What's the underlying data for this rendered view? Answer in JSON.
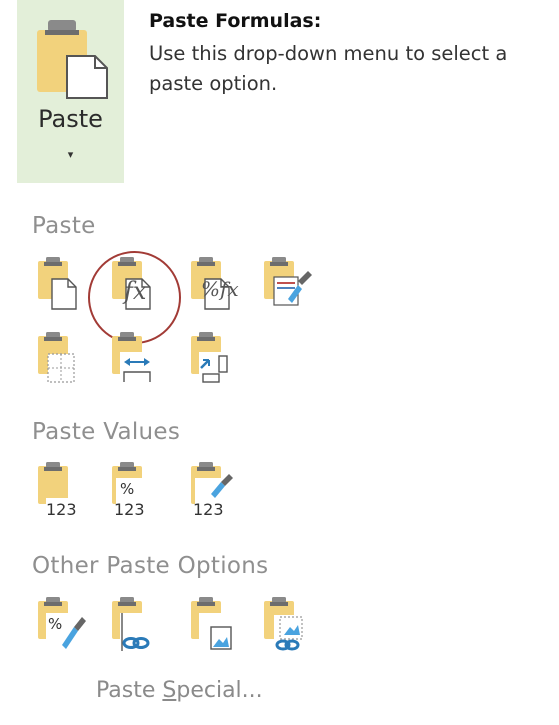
{
  "paste_button": {
    "label": "Paste",
    "arrow": "▾"
  },
  "description": {
    "title": "Paste Formulas:",
    "body": "Use this drop-down menu to select a paste option."
  },
  "sections": {
    "paste": "Paste",
    "values": "Paste Values",
    "other": "Other Paste Options"
  },
  "icons": {
    "formulas": "fx",
    "formulas_number_formatting": "%fx",
    "pct": "%",
    "num": "123"
  },
  "special": {
    "before": "Paste ",
    "underlined": "S",
    "after": "pecial..."
  },
  "colors": {
    "button_bg": "#e3efd9",
    "clipboard": "#f2d27c",
    "circle": "#a23b36"
  }
}
